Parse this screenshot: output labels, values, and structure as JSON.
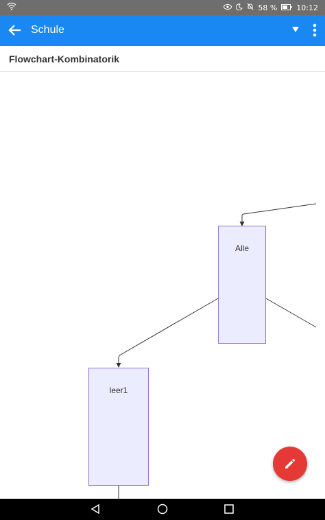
{
  "status_bar": {
    "battery": "58 %",
    "time": "10:12",
    "icons": [
      "wifi-icon",
      "eye-icon",
      "moon-icon",
      "bell-off-icon",
      "battery-icon"
    ]
  },
  "app_bar": {
    "title": "Schule",
    "icons": [
      "back-arrow-icon",
      "dropdown-arrow-icon",
      "more-vert-icon"
    ]
  },
  "page": {
    "title": "Flowchart-Kombinatorik"
  },
  "diagram": {
    "nodes": [
      {
        "id": "alle",
        "label": "Alle"
      },
      {
        "id": "leer1",
        "label": "leer1"
      }
    ],
    "colors": {
      "node_fill": "#ececff",
      "node_stroke": "#9370db",
      "edge": "#333333"
    }
  },
  "fab": {
    "icon": "edit-pencil-icon",
    "color": "#e53935"
  },
  "nav_bar": {
    "icons": [
      "back-triangle-icon",
      "home-circle-icon",
      "recents-square-icon"
    ]
  }
}
